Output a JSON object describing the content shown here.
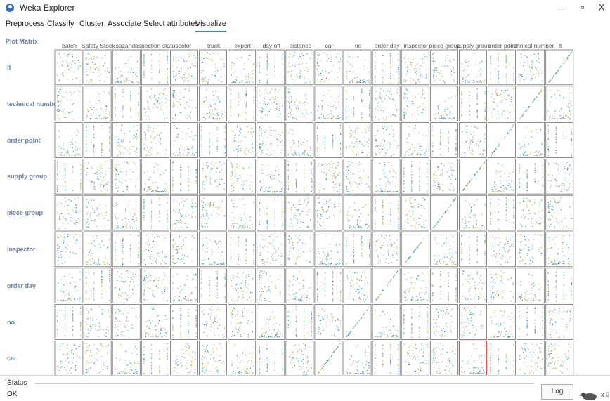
{
  "window": {
    "title": "Weka Explorer",
    "minimize": "–",
    "maximize": "▫",
    "close": "X"
  },
  "tabs": [
    "Preprocess",
    "Classify",
    "Cluster",
    "Associate",
    "Select attributes",
    "Visualize"
  ],
  "active_tab": "Visualize",
  "plot": {
    "title": "Plot Matrix",
    "columns": [
      "batch",
      "Safety Stock",
      "sazande",
      "inspection status",
      "color",
      "truck",
      "expert",
      "day off",
      "distance",
      "car",
      "no",
      "order day",
      "inspector",
      "piece group",
      "supply group",
      "order point",
      "technical number",
      "lt"
    ],
    "rows": [
      "lt",
      "technical number",
      "order point",
      "supply group",
      "piece group",
      "inspector",
      "order day",
      "no",
      "car"
    ],
    "point_colors": [
      "#2e7fb8",
      "#55a8d8",
      "#9fb95a",
      "#c8b46a"
    ],
    "selected_cell": {
      "row": "car",
      "column": "supply group",
      "border_color": "#e05050"
    }
  },
  "status": {
    "label": "Status",
    "text": "OK"
  },
  "log_button": "Log",
  "x_count": "x 0"
}
